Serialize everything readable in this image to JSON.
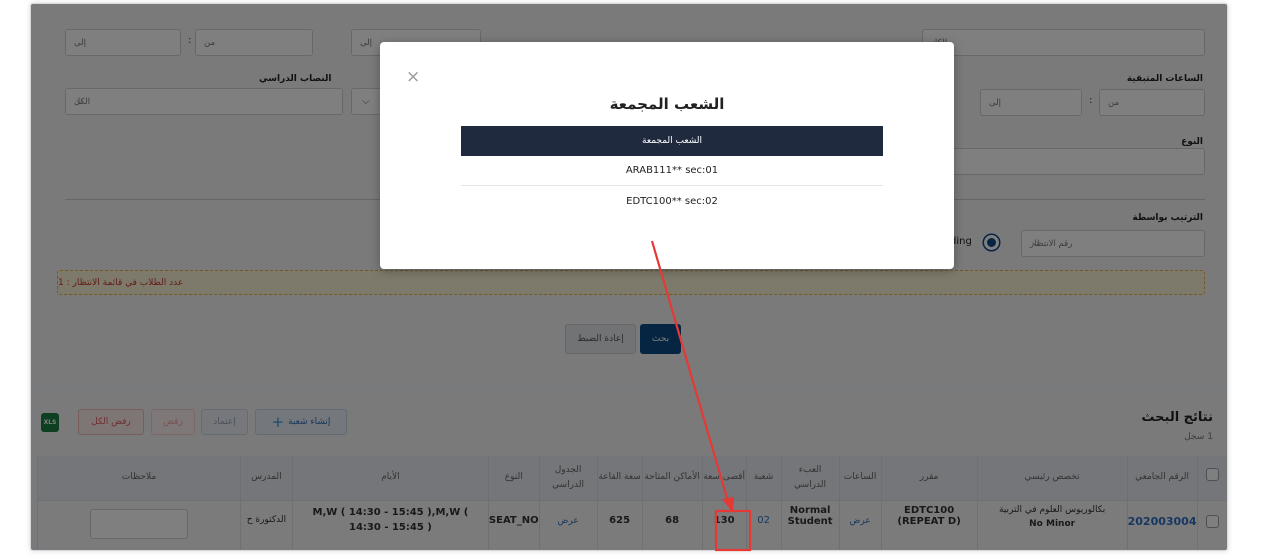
{
  "filters": {
    "from_placeholder": "من",
    "to_placeholder": "إلى",
    "all_option": "الكل",
    "colon": ":",
    "study_load_label": "النصاب الدراسي",
    "remaining_hours_label": "الساعات المتبقية",
    "type_label": "النوع",
    "sort_by_label": "الترتيب بواسطة",
    "sort_value": "رقم الانتظار",
    "sort_direction_text": "ding",
    "waitlist_notice": "عدد الطلاب في قائمة الانتظار : 1",
    "reset_button": "إعادة الضبط",
    "search_button": "بحث"
  },
  "modal": {
    "close": "×",
    "title": "الشعب المجمعة",
    "table_header": "الشعب المجمعة",
    "rows": [
      "ARAB111** sec:01",
      "EDTC100** sec:02"
    ]
  },
  "results": {
    "title": "نتائج البحث",
    "count": "1 سجل",
    "excel_label": "XLS",
    "create_section": "إنشاء شعبة",
    "approve": "إعتماد",
    "reject": "رفض",
    "reject_all": "رفض الكل",
    "columns": [
      "الرقم الجامعي",
      "تخصص رئيسي",
      "مقرر",
      "الساعات",
      "العبء الدراسي",
      "شعبة",
      "أقصى سعة",
      "الأماكن المتاحة",
      "سعة القاعة",
      "الجدول الدراسي",
      "النوع",
      "الأيام",
      "المدرس",
      "ملاحظات"
    ],
    "row": {
      "student_id": "202003004",
      "major": "بكالوريوس العلوم في التربية",
      "major_sub": "No Minor",
      "course": "EDTC100",
      "course_sub": "(REPEAT D)",
      "hours_link": "عرض",
      "load": "Normal",
      "load_sub": "Student",
      "section": "02",
      "max_capacity": "130",
      "available": "68",
      "room_capacity": "625",
      "schedule_link": "عرض",
      "type": "SEAT_NO",
      "days": "M,W ( 14:30 - 15:45 ),M,W ( 14:30 - 15:45 )",
      "instructor": "الدكتورة ح",
      "notes": ""
    }
  },
  "colors": {
    "primary": "#0b4a86",
    "modal_header": "#1f2a3f",
    "annotation": "#e53935",
    "warning_bg": "#fdf4d6"
  }
}
